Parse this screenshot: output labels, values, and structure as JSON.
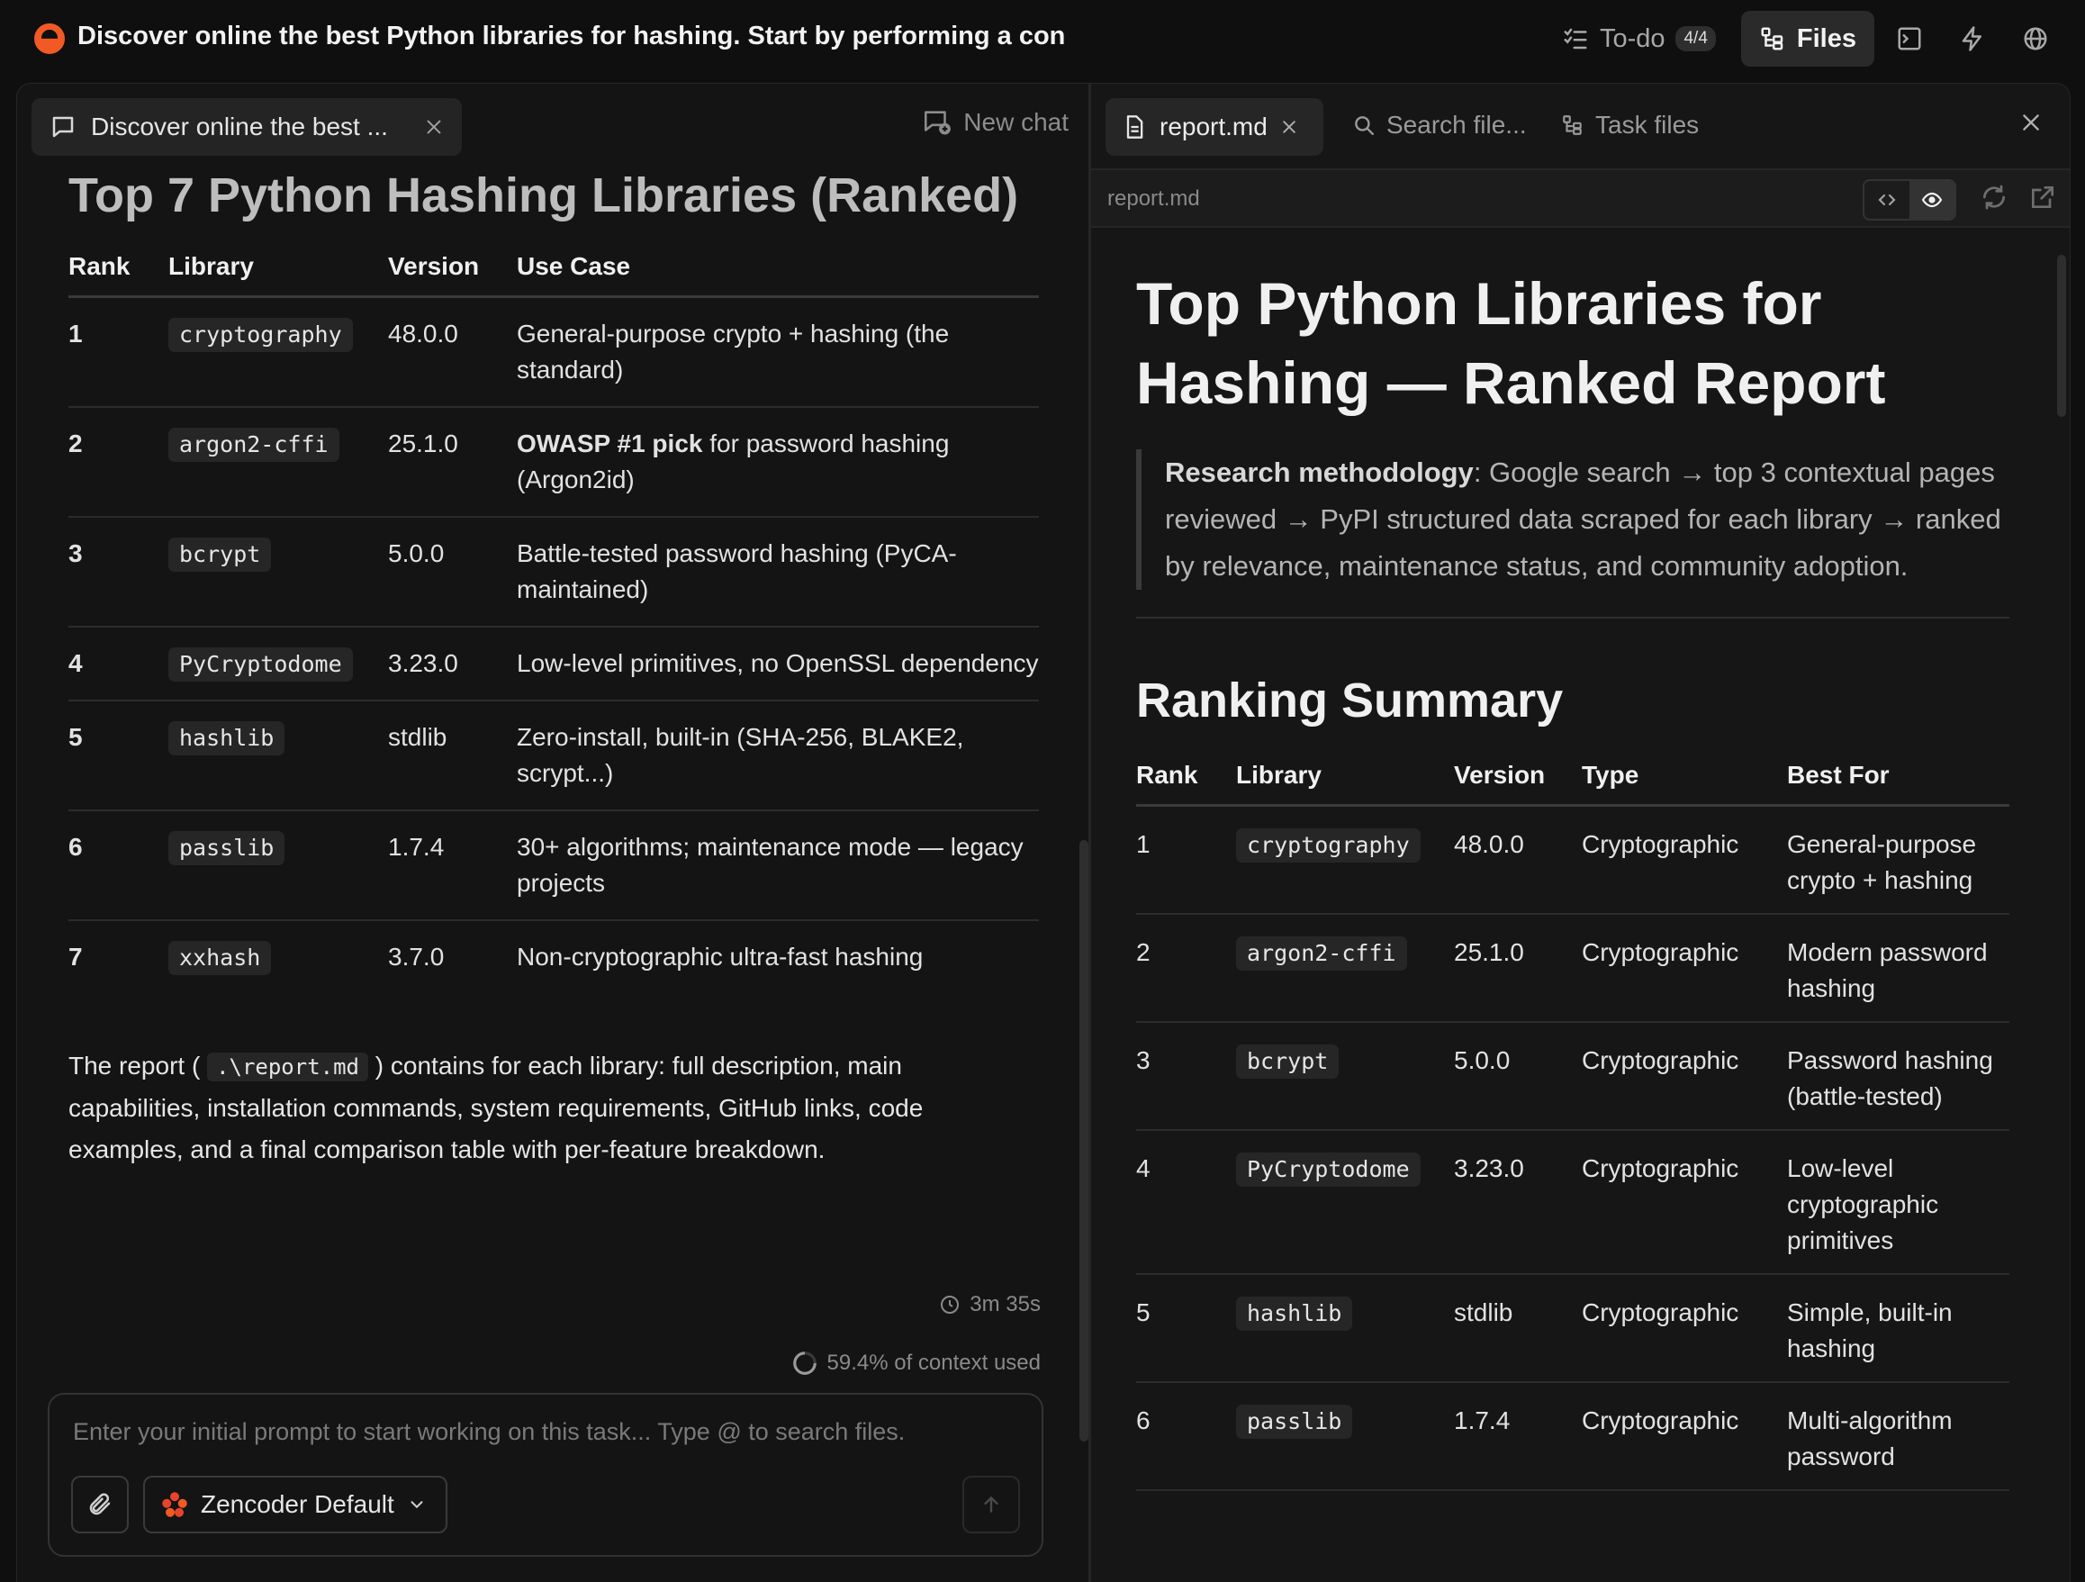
{
  "app": {
    "title": "Discover online the best Python libraries for hashing. Start by performing a con"
  },
  "topbar": {
    "todo_label": "To-do",
    "todo_badge": "4/4",
    "files_label": "Files"
  },
  "chat": {
    "tab_label": "Discover online the best ...",
    "new_chat_label": "New chat",
    "heading": "Top 7 Python Hashing Libraries (Ranked)",
    "table": {
      "headers": [
        "Rank",
        "Library",
        "Version",
        "Use Case"
      ],
      "rows": [
        {
          "rank": "1",
          "library": "cryptography",
          "version": "48.0.0",
          "use_case_bold": "",
          "use_case": "General-purpose crypto + hashing (the standard)"
        },
        {
          "rank": "2",
          "library": "argon2-cffi",
          "version": "25.1.0",
          "use_case_bold": "OWASP #1 pick",
          "use_case": " for password hashing (Argon2id)"
        },
        {
          "rank": "3",
          "library": "bcrypt",
          "version": "5.0.0",
          "use_case_bold": "",
          "use_case": "Battle-tested password hashing (PyCA-maintained)"
        },
        {
          "rank": "4",
          "library": "PyCryptodome",
          "version": "3.23.0",
          "use_case_bold": "",
          "use_case": "Low-level primitives, no OpenSSL dependency"
        },
        {
          "rank": "5",
          "library": "hashlib",
          "version": "stdlib",
          "use_case_bold": "",
          "use_case": "Zero-install, built-in (SHA-256, BLAKE2, scrypt...)"
        },
        {
          "rank": "6",
          "library": "passlib",
          "version": "1.7.4",
          "use_case_bold": "",
          "use_case": "30+ algorithms; maintenance mode — legacy projects"
        },
        {
          "rank": "7",
          "library": "xxhash",
          "version": "3.7.0",
          "use_case_bold": "",
          "use_case": "Non-cryptographic ultra-fast hashing"
        }
      ]
    },
    "paragraph_before": "The report (",
    "paragraph_code": ".\\report.md",
    "paragraph_after": ") contains for each library: full description, main capabilities, installation commands, system requirements, GitHub links, code examples, and a final comparison table with per-feature breakdown.",
    "duration": "3m 35s",
    "context_used": "59.4% of context used",
    "input_placeholder": "Enter your initial prompt to start working on this task... Type @ to search files.",
    "model_label": "Zencoder Default"
  },
  "files_panel": {
    "file_tab_label": "report.md",
    "search_label": "Search file...",
    "task_files_label": "Task files",
    "toolbar_filename": "report.md",
    "doc": {
      "title": "Top Python Libraries for Hashing — Ranked Report",
      "quote_bold": "Research methodology",
      "quote_text": ": Google search → top 3 contextual pages reviewed → PyPI structured data scraped for each library → ranked by relevance, maintenance status, and community adoption.",
      "section_heading": "Ranking Summary",
      "table": {
        "headers": [
          "Rank",
          "Library",
          "Version",
          "Type",
          "Best For"
        ],
        "rows": [
          {
            "rank": "1",
            "library": "cryptography",
            "version": "48.0.0",
            "type": "Cryptographic",
            "best_for": "General-purpose crypto + hashing"
          },
          {
            "rank": "2",
            "library": "argon2-cffi",
            "version": "25.1.0",
            "type": "Cryptographic",
            "best_for": "Modern password hashing"
          },
          {
            "rank": "3",
            "library": "bcrypt",
            "version": "5.0.0",
            "type": "Cryptographic",
            "best_for": "Password hashing (battle-tested)"
          },
          {
            "rank": "4",
            "library": "PyCryptodome",
            "version": "3.23.0",
            "type": "Cryptographic",
            "best_for": "Low-level cryptographic primitives"
          },
          {
            "rank": "5",
            "library": "hashlib",
            "version": "stdlib",
            "type": "Cryptographic",
            "best_for": "Simple, built-in hashing"
          },
          {
            "rank": "6",
            "library": "passlib",
            "version": "1.7.4",
            "type": "Cryptographic",
            "best_for": "Multi-algorithm password"
          }
        ]
      }
    }
  },
  "colors": {
    "accent": "#f15a24",
    "background": "#0f0f0f",
    "panel": "#141414"
  },
  "icons": [
    "zencoder-logo-icon",
    "checklist-icon",
    "files-icon",
    "terminal-icon",
    "lightning-icon",
    "globe-icon",
    "chat-bubble-icon",
    "close-icon",
    "new-chat-icon",
    "clock-icon",
    "spinner-icon",
    "paperclip-icon",
    "zencoder-flower-icon",
    "chevron-down-icon",
    "arrow-up-icon",
    "document-icon",
    "search-icon",
    "code-icon",
    "eye-icon",
    "refresh-icon",
    "external-link-icon"
  ]
}
